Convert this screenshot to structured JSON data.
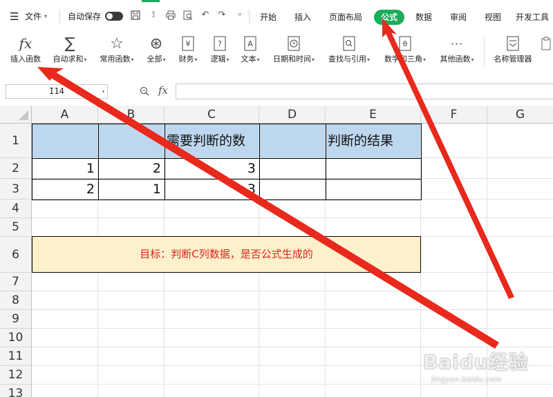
{
  "menubar": {
    "file_label": "文件",
    "autosave_label": "自动保存",
    "tabs": [
      "开始",
      "插入",
      "页面布局",
      "公式",
      "数据",
      "审阅",
      "视图",
      "开发工具"
    ],
    "active_tab": "公式",
    "accent_color": "#1aad5a"
  },
  "ribbon": {
    "items": [
      {
        "label": "插入函数",
        "icon": "fx-icon"
      },
      {
        "label": "自动求和",
        "icon": "sigma-icon"
      },
      {
        "label": "常用函数",
        "icon": "star-icon"
      },
      {
        "label": "全部",
        "icon": "asterisk-circle-icon"
      },
      {
        "label": "财务",
        "icon": "yen-book-icon"
      },
      {
        "label": "逻辑",
        "icon": "question-book-icon"
      },
      {
        "label": "文本",
        "icon": "text-book-icon"
      },
      {
        "label": "日期和时间",
        "icon": "clock-book-icon"
      },
      {
        "label": "查找与引用",
        "icon": "search-book-icon"
      },
      {
        "label": "数学和三角",
        "icon": "theta-book-icon"
      },
      {
        "label": "其他函数",
        "icon": "more-dots-icon"
      },
      {
        "label": "名称管理器",
        "icon": "name-manager-icon"
      }
    ]
  },
  "formula_bar": {
    "cell_ref": "I14",
    "fx_label": "fx",
    "formula": ""
  },
  "sheet": {
    "columns": [
      "A",
      "B",
      "C",
      "D",
      "E",
      "F",
      "G"
    ],
    "rows": [
      "1",
      "2",
      "3",
      "4",
      "5",
      "6",
      "7",
      "8",
      "9",
      "10",
      "11",
      "12",
      "13"
    ],
    "header_row": {
      "C": "需要判断的数",
      "E": "判断的结果"
    },
    "data": [
      {
        "A": "1",
        "B": "2",
        "C": "3"
      },
      {
        "A": "2",
        "B": "1",
        "C": "3"
      }
    ],
    "goal_text": "目标：判断C列数据，是否公式生成的",
    "header_fill": "#bdd7ee",
    "goal_fill": "#fdf1cc",
    "goal_text_color": "#e02020"
  },
  "watermark": {
    "brand": "Baidu经验",
    "url": "jingyan.baidu.com"
  }
}
